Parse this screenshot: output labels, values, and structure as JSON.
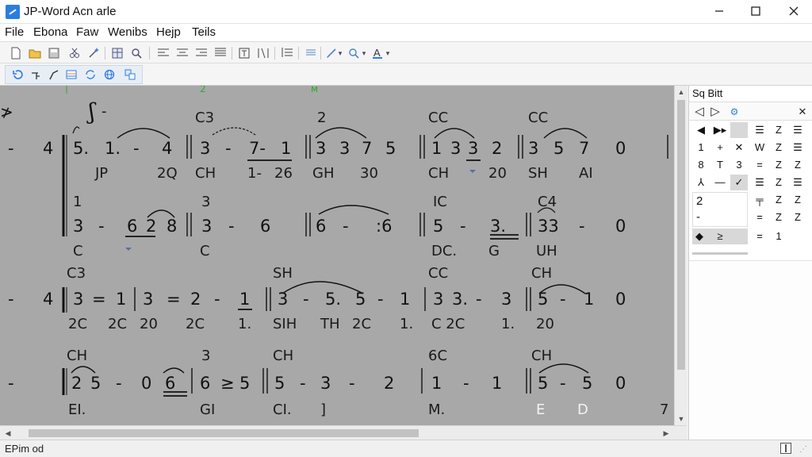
{
  "window": {
    "title": "JP-Word Acn arle",
    "minimize_label": "—",
    "maximize_label": "☐",
    "close_label": "✕"
  },
  "menu": [
    "File",
    "Ebona",
    "Faw",
    "Wenibs",
    "Hejp",
    "Teils"
  ],
  "toolbar": {
    "icons": [
      "new-document-icon",
      "open-folder-icon",
      "save-icon",
      "cut-icon",
      "magic-icon",
      "table-icon",
      "find-icon",
      "align-left-icon",
      "align-center-icon",
      "align-right-icon",
      "justify-icon",
      "text-box-icon",
      "columns-icon",
      "list-icon",
      "line-spacing-icon",
      "pen-icon",
      "zoom-icon",
      "font-color-icon"
    ],
    "zoom_arrow": "▾"
  },
  "toolbar2": {
    "icons": [
      "undo-icon",
      "chord-icon",
      "slur-icon",
      "bar-icon",
      "loop-icon",
      "globe-icon",
      "insert-icon"
    ]
  },
  "score": {
    "header_marks": [
      "2",
      "ᴍ"
    ],
    "rows": [
      {
        "key": "4",
        "chords_top": [
          "C3",
          "2",
          "CC",
          "CC"
        ],
        "upper": [
          "5.",
          "1.",
          "-",
          "4",
          "3",
          "-",
          "7-",
          "1",
          "3",
          "3",
          "7",
          "5",
          "1",
          "3",
          "3",
          "2",
          "3",
          "5",
          "7",
          "0"
        ],
        "lyrics": [
          "JP",
          "2Q",
          "CH",
          "1-",
          "26",
          "GH",
          "30",
          "CH",
          "20",
          "SH",
          "AI"
        ],
        "chords_mid": [
          "1",
          "3",
          "IC",
          "C4"
        ],
        "lower": [
          "3",
          "-",
          "6",
          "2",
          "8",
          "3",
          "-",
          "6",
          "6",
          "-",
          ":6",
          "5",
          "-",
          "3.",
          "3",
          "33",
          "-",
          "0"
        ],
        "lyrics2": [
          "C",
          "C",
          "DC.",
          "G",
          "UH"
        ]
      },
      {
        "key": "4",
        "chords_top": [
          "C3",
          "SH",
          "CC",
          "CH"
        ],
        "upper": [
          "3",
          "=",
          "1",
          "3",
          "=",
          "2",
          "-",
          "1",
          "3",
          "-",
          "5.",
          "5",
          "-",
          "1",
          "3",
          "3.",
          "-",
          "3",
          "5",
          "-",
          "1",
          "0"
        ],
        "lyrics": [
          "2C",
          "2C",
          "20",
          "2C",
          "1.",
          "SIH",
          "TH",
          "2C",
          "1.",
          "C 2C",
          "1.",
          "20"
        ]
      },
      {
        "key": "",
        "chords_top": [
          "CH",
          "3",
          "CH",
          "6C",
          "CH"
        ],
        "upper": [
          "2",
          "5",
          "-",
          "0",
          "6",
          "6",
          "≥",
          "5",
          "5",
          "-",
          "3",
          "-",
          "2",
          "1",
          "-",
          "1",
          "5",
          "-",
          "5",
          "0"
        ],
        "lyrics": [
          "EI.",
          "GI",
          "CI.",
          "]",
          "M.",
          "E",
          "D",
          "7"
        ]
      }
    ]
  },
  "panel": {
    "title": "Sq Bitt",
    "nav_prev": "◁",
    "nav_next": "▷",
    "close": "✕",
    "grid": [
      [
        "◀",
        "▶▸",
        "",
        "☰",
        "Z",
        "☰"
      ],
      [
        "1",
        "+",
        "✕",
        "W",
        "Z",
        "☰"
      ],
      [
        "8",
        "T",
        "3",
        "=",
        "Z",
        "Z"
      ],
      [
        "⅄",
        "—",
        "✓",
        "☰",
        "Z",
        "☰"
      ],
      [
        "",
        "",
        "",
        "╤",
        "Z",
        "Z"
      ],
      [
        "",
        "",
        "",
        "=",
        "Z",
        "Z"
      ],
      [
        "◆",
        "≥",
        "",
        "=",
        "1",
        ""
      ]
    ],
    "input_values": [
      "2",
      "-"
    ]
  },
  "status": {
    "text": "EPim od"
  }
}
